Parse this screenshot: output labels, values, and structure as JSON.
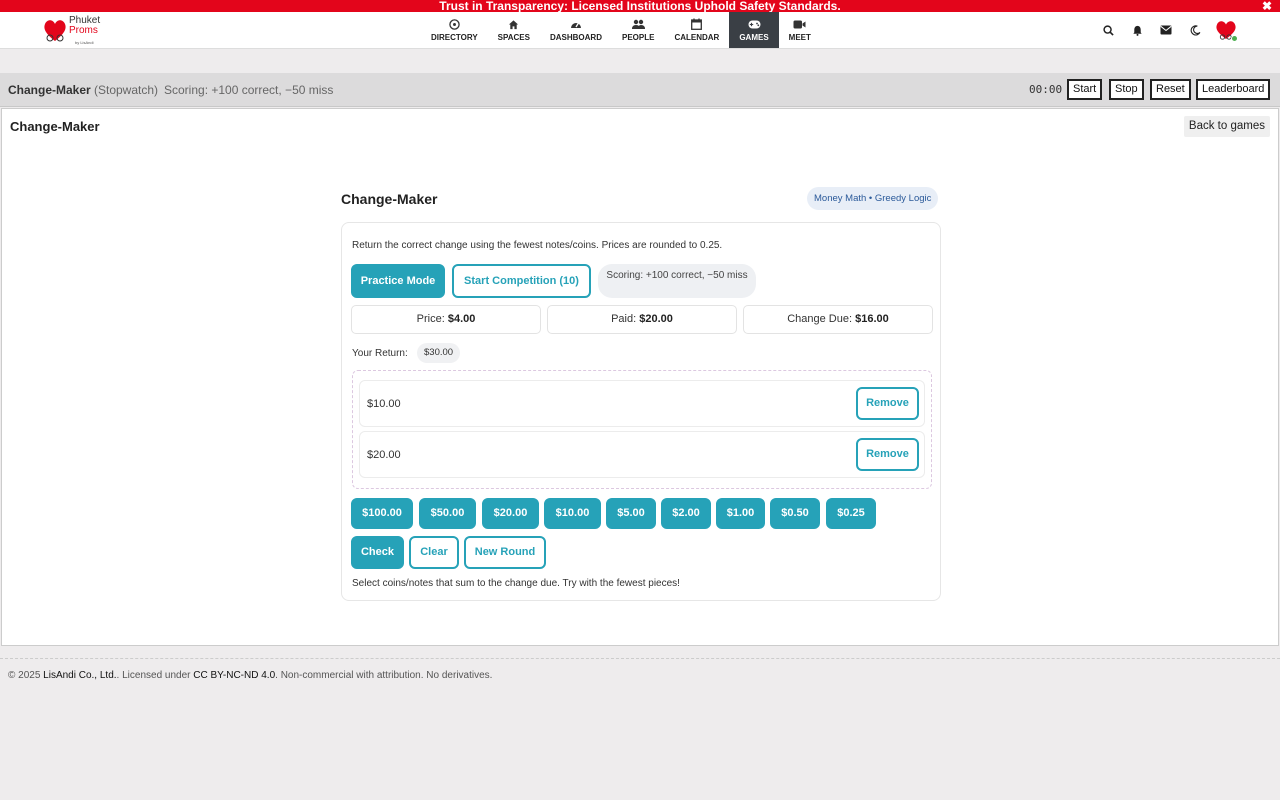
{
  "banner": {
    "text": "Trust in Transparency: Licensed Institutions Uphold Safety Standards.",
    "close": "✖"
  },
  "brand": {
    "name_line1": "Phuket",
    "name_line2": "Proms",
    "byline": "by LisAndi"
  },
  "nav": {
    "items": [
      {
        "label": "DIRECTORY",
        "icon": "compass-icon"
      },
      {
        "label": "SPACES",
        "icon": "home-icon"
      },
      {
        "label": "DASHBOARD",
        "icon": "gauge-icon"
      },
      {
        "label": "PEOPLE",
        "icon": "people-icon"
      },
      {
        "label": "CALENDAR",
        "icon": "calendar-icon"
      },
      {
        "label": "GAMES",
        "icon": "gamepad-icon",
        "active": true
      },
      {
        "label": "MEET",
        "icon": "video-icon"
      }
    ],
    "right_icons": [
      "search-icon",
      "bell-icon",
      "envelope-icon",
      "moon-icon"
    ]
  },
  "gamebar": {
    "title": "Change-Maker",
    "mode": "(Stopwatch)",
    "scoring": "Scoring: +100 correct, −50 miss",
    "timer": "00:00",
    "start": "Start",
    "stop": "Stop",
    "reset": "Reset",
    "leaderboard": "Leaderboard"
  },
  "panel": {
    "title": "Change-Maker",
    "back": "Back to games"
  },
  "game": {
    "title": "Change-Maker",
    "tag": "Money Math • Greedy Logic",
    "description": "Return the correct change using the fewest notes/coins. Prices are rounded to 0.25.",
    "practice": "Practice Mode",
    "competition": "Start Competition (10)",
    "scoring": "Scoring: +100 correct, −50 miss",
    "price_label": "Price:",
    "price": "$4.00",
    "paid_label": "Paid:",
    "paid": "$20.00",
    "due_label": "Change Due:",
    "due": "$16.00",
    "return_label": "Your Return:",
    "return_total": "$30.00",
    "returns": [
      {
        "amount": "$10.00",
        "remove": "Remove"
      },
      {
        "amount": "$20.00",
        "remove": "Remove"
      }
    ],
    "denominations": [
      "$100.00",
      "$50.00",
      "$20.00",
      "$10.00",
      "$5.00",
      "$2.00",
      "$1.00",
      "$0.50",
      "$0.25"
    ],
    "check": "Check",
    "clear": "Clear",
    "new_round": "New Round",
    "hint": "Select coins/notes that sum to the change due. Try with the fewest pieces!"
  },
  "footer": {
    "copyright": "© 2025 ",
    "company": "LisAndi Co., Ltd.",
    "licensed": ". Licensed under ",
    "license": "CC BY-NC-ND 4.0",
    "note": ". Non-commercial with attribution. No derivatives."
  },
  "colors": {
    "accent": "#26a2b8",
    "banner": "#e3051b",
    "active_nav": "#3a3f45"
  }
}
